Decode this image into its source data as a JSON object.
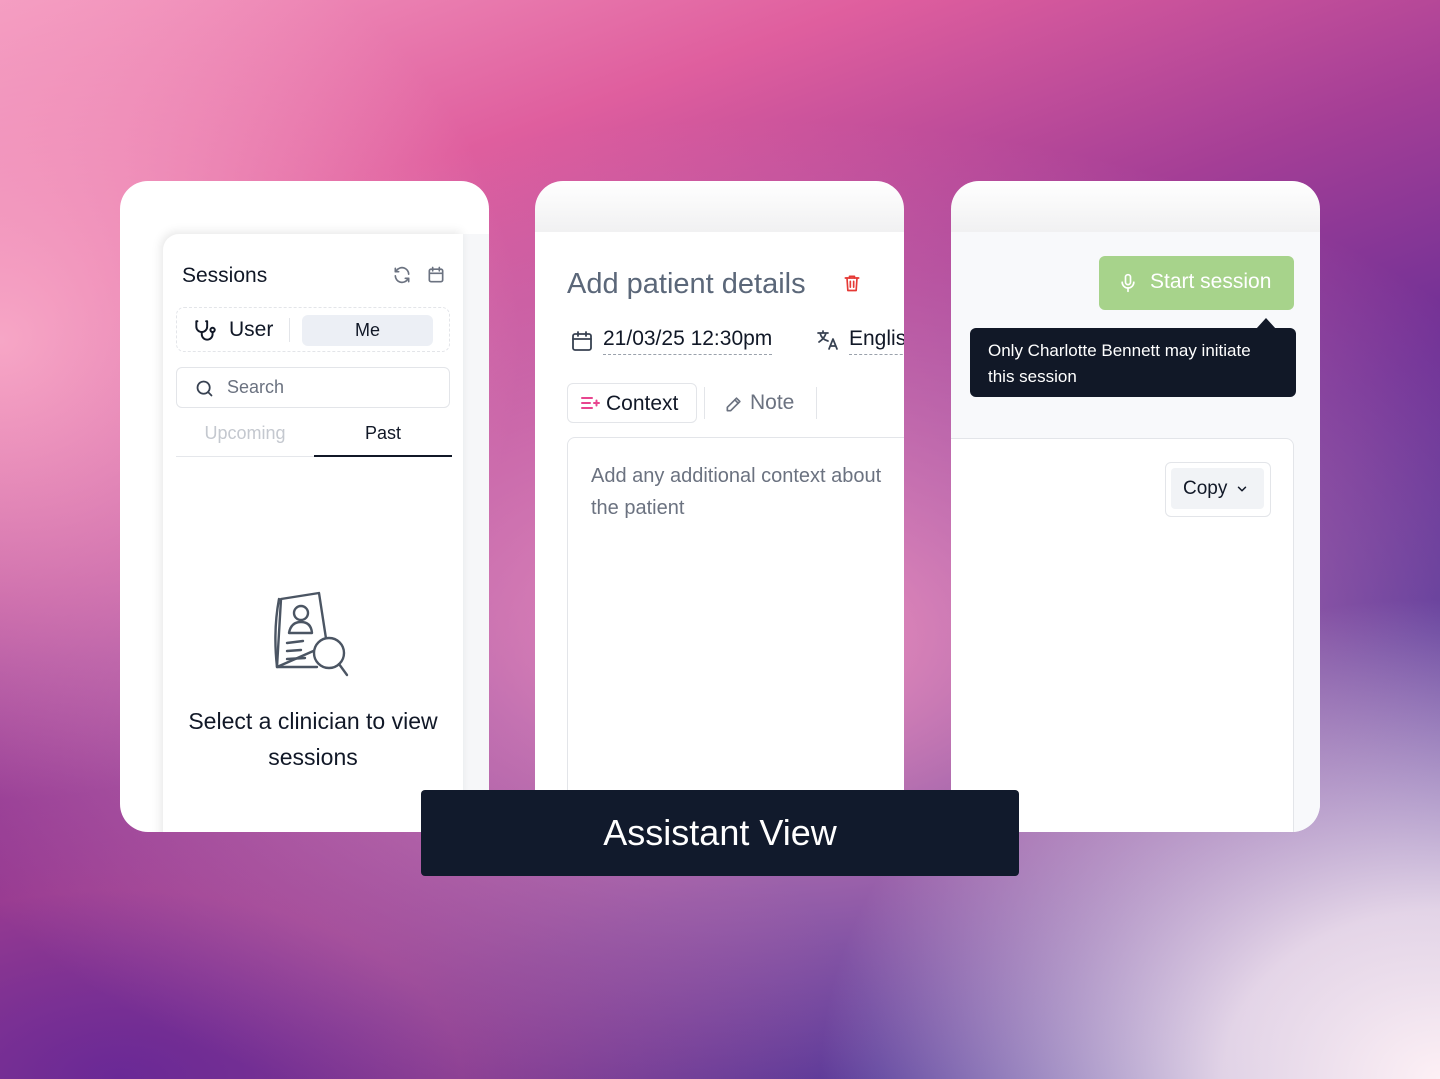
{
  "sessions_card": {
    "title": "Sessions",
    "icons": [
      "refresh-icon",
      "calendar-icon"
    ],
    "clinician_filter": {
      "icon": "stethoscope-icon",
      "label": "User",
      "selected_value": "Me"
    },
    "search": {
      "placeholder": "Search"
    },
    "tabs": [
      {
        "label": "Upcoming",
        "active": false
      },
      {
        "label": "Past",
        "active": true
      }
    ],
    "empty_state": {
      "icon": "patient-record-search-icon",
      "message": "Select a clinician to view sessions"
    }
  },
  "patient_card": {
    "title": "Add patient details",
    "delete_icon": "trash-icon",
    "datetime": {
      "icon": "calendar-icon",
      "value": "21/03/25 12:30pm"
    },
    "language": {
      "icon": "translate-icon",
      "value": "English"
    },
    "tabs": [
      {
        "label": "Context",
        "icon": "context-list-icon",
        "active": true
      },
      {
        "label": "Note",
        "icon": "pencil-icon",
        "active": false
      }
    ],
    "context_placeholder": "Add any additional context about the patient"
  },
  "session_card": {
    "start_button": {
      "label": "Start session",
      "icon": "microphone-icon",
      "disabled": true
    },
    "tooltip": "Only Charlotte Bennett may initiate this session",
    "copy_button": {
      "label": "Copy",
      "icon": "chevron-down-icon"
    }
  },
  "banner": {
    "title": "Assistant View"
  },
  "colors": {
    "text_primary": "#111827",
    "start_button_bg": "#a7d38b",
    "delete_red": "#e53935",
    "context_accent": "#e8458f",
    "banner_bg": "#111a2c"
  }
}
